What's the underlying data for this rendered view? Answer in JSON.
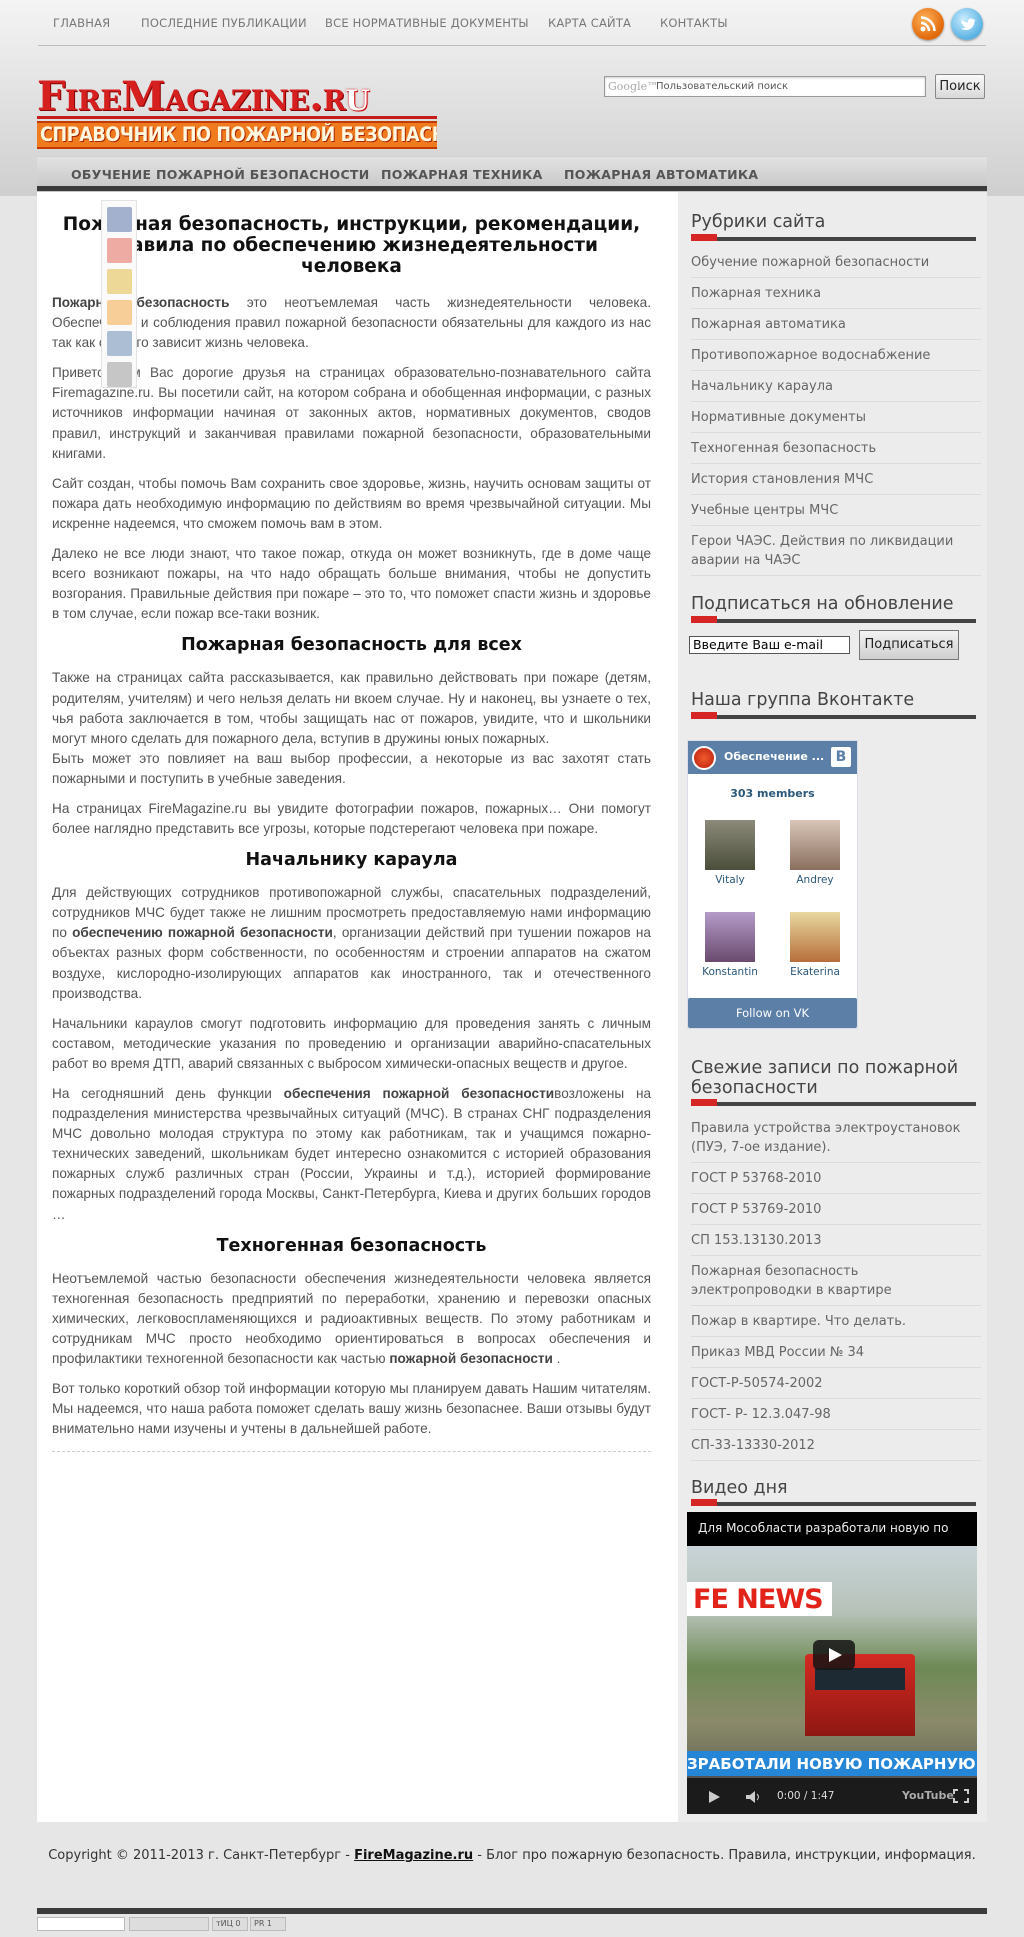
{
  "topnav": {
    "items": [
      "ГЛАВНАЯ",
      "ПОСЛЕДНИЕ ПУБЛИКАЦИИ",
      "ВСЕ НОРМАТИВНЫЕ ДОКУМЕНТЫ",
      "КАРТА САЙТА",
      "КОНТАКТЫ"
    ],
    "social": [
      "rss-icon",
      "twitter-icon"
    ]
  },
  "logo": {
    "main_a": "FireMagazine.r",
    "main_b": "u",
    "sub": "СПРАВОЧНИК ПО ПОЖАРНОЙ БЕЗОПАСНОСТИ"
  },
  "search": {
    "brand": "Google™",
    "placeholder": "Пользовательский поиск",
    "button": "Поиск"
  },
  "catnav": {
    "items": [
      "ОБУЧЕНИЕ ПОЖАРНОЙ БЕЗОПАСНОСТИ",
      "ПОЖАРНАЯ ТЕХНИКА",
      "ПОЖАРНАЯ АВТОМАТИКА"
    ]
  },
  "share": [
    "facebook-icon",
    "google-plus-icon",
    "mail-ru-icon",
    "odnoklassniki-icon",
    "vkontakte-icon",
    "bookmark-icon"
  ],
  "article": {
    "title": "Пожарная безопасность, инструкции, рекомендации, правила по обеспечению жизнедеятельности человека",
    "p1_bold": "Пожарная безопасность",
    "p1": " это неотъемлемая часть жизнедеятельности человека. Обеспечение и соблюдения правил пожарной безопасности обязательны для каждого из нас так как от этого зависит жизнь человека.",
    "p2": "Приветствуем Вас дорогие друзья на страницах образовательно-познавательного сайта Firemagazine.ru. Вы посетили сайт, на котором собрана и обобщенная информации, с разных источников информации начиная от законных актов, нормативных документов, сводов правил, инструкций и заканчивая правилами пожарной безопасности, образовательными книгами.",
    "p3": "Сайт создан, чтобы помочь Вам сохранить свое здоровье, жизнь, научить основам защиты от пожара дать необходимую информацию по действиям во время чрезвычайной ситуации. Мы искренне надеемся, что сможем помочь вам в этом.",
    "p4": "Далеко не все люди знают, что такое пожар, откуда он может возникнуть, где в доме чаще всего возникают пожары, на что надо обращать больше внимания, чтобы не допустить возгорания. Правильные действия при пожаре – это то, что поможет спасти жизнь и здоровье в том случае, если пожар все-таки возник.",
    "h2_1": "Пожарная безопасность для всех",
    "p5": "Также на страницах сайта рассказывается, как правильно действовать при пожаре (детям, родителям, учителям) и чего нельзя делать ни вкоем случае. Ну и наконец, вы узнаете о тех, чья работа заключается в том, чтобы защищать нас от пожаров, увидите, что и школьники могут много сделать для пожарного дела, вступив в дружины юных пожарных.",
    "p5b": "Быть может это повлияет на ваш выбор профессии, а некоторые из вас захотят стать пожарными и поступить в учебные заведения.",
    "p6": "На страницах FireMagazine.ru вы увидите фотографии пожаров, пожарных… Они помогут более наглядно представить все угрозы, которые подстерегают человека при пожаре.",
    "h2_2": "Начальнику караула",
    "p7a": "Для действующих сотрудников противопожарной службы, спасательных подразделений, сотрудников МЧС будет также не лишним просмотреть предоставляемую нами информацию по ",
    "p7_bold": "обеспечению пожарной безопасности",
    "p7b": ", организации действий при тушении пожаров на объектах разных форм собственности, по особенностям и строении аппаратов на сжатом воздухе, кислородно-изолирующих аппаратов как иностранного, так и отечественного производства.",
    "p8": "Начальники караулов смогут подготовить информацию для проведения занять с личным составом, методические указания по проведению и организации аварийно-спасательных работ во время ДТП, аварий связанных с выбросом химически-опасных веществ и другое.",
    "p9a": "На сегодняшний день функции ",
    "p9_bold": "обеспечения пожарной безопасности",
    "p9b": "возложены на подразделения министерства чрезвычайных ситуаций (МЧС). В странах СНГ подразделения МЧС довольно молодая структура по этому как работникам, так и учащимся пожарно-технических заведений, школьникам будет интересно ознакомится с историей образования пожарных служб различных стран (России, Украины и т.д.), историей формирование пожарных подразделений города Москвы, Санкт-Петербурга, Киева и других больших городов …",
    "h2_3": "Техногенная безопасность",
    "p10a": "Неотъемлемой частью безопасности обеспечения жизнедеятельности человека является техногенная безопасность предприятий по переработки, хранению и перевозки опасных химических, легковоспламеняющихся и радиоактивных веществ. По этому работникам и сотрудникам МЧС просто необходимо ориентироваться в вопросах обеспечения и профилактики техногенной безопасности как частью ",
    "p10_bold": "пожарной безопасности",
    "p10b": " .",
    "p11": "Вот только короткий обзор той информации которую мы планируем давать Нашим читателям. Мы надеемся, что наша работа поможет сделать вашу жизнь безопаснее. Ваши отзывы будут внимательно нами изучены и учтены в дальнейшей работе."
  },
  "sidebar": {
    "rubrics_title": "Рубрики сайта",
    "rubrics": [
      "Обучение пожарной безопасности",
      "Пожарная техника",
      "Пожарная автоматика",
      "Противопожарное водоснабжение",
      "Начальнику караула",
      "Нормативные документы",
      "Техногенная безопасность",
      "История становления МЧС",
      "Учебные центры МЧС",
      "Герои ЧАЭС. Действия по ликвидации аварии на ЧАЭС"
    ],
    "subscribe_title": "Подписаться на обновление",
    "subscribe_value": "Введите Ваш e-mail",
    "subscribe_button": "Подписаться",
    "vk_title": "Наша группа Вконтакте",
    "vk_group_name": "Обеспечение ...",
    "vk_letter": "B",
    "vk_members": "303 members",
    "vk_people": [
      "Vitaly",
      "Andrey",
      "Konstantin",
      "Ekaterina"
    ],
    "vk_follow": "Follow on VK",
    "recent_title": "Свежие записи по пожарной безопасности",
    "recent": [
      "Правила устройства электроустановок (ПУЭ, 7-ое издание).",
      "ГОСТ Р 53768-2010",
      "ГОСТ Р 53769-2010",
      "СП 153.13130.2013",
      "Пожарная безопасность электропроводки в квартире",
      "Пожар в квартире. Что делать.",
      "Приказ МВД России № 34",
      "ГОСТ-Р-50574-2002",
      "ГОСТ- Р- 12.3.047-98",
      "СП-33-13330-2012"
    ],
    "video_title": "Видео дня",
    "video_caption": "Для Мособласти разработали новую по",
    "video_logo": "FE NEWS",
    "video_banner": "ЗРАБОТАЛИ НОВУЮ ПОЖАРНУЮ МАШ",
    "video_time": "0:00 / 1:47",
    "video_brand": "YouTube"
  },
  "footer": {
    "copyright_a": "Copyright © 2011-2013 г. Санкт-Петербург - ",
    "copyright_link": "FireMagazine.ru",
    "copyright_b": " - Блог про пожарную безопасность. Правила, инструкции, информация."
  },
  "counters": [
    "тИЦ 0",
    "PR 1"
  ],
  "colors": {
    "accent_red": "#d52525",
    "logo_orange": "#f07b1e",
    "vk_blue": "#5b7fa6",
    "bar_dark": "#3b3b3b"
  }
}
